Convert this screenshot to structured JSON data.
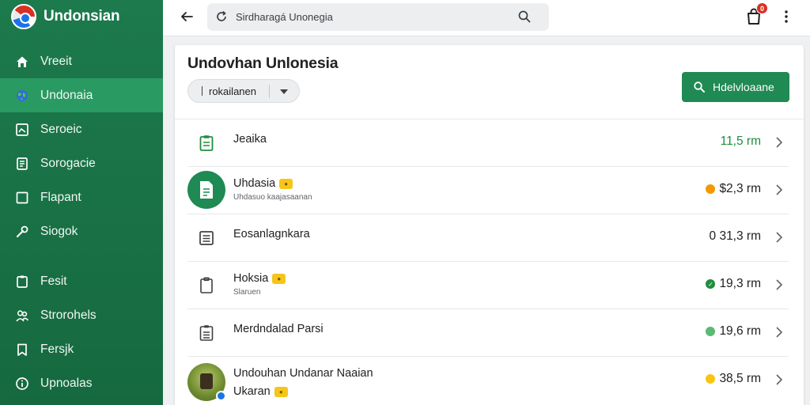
{
  "app": {
    "name": "Undonsian"
  },
  "sidebar": {
    "items": [
      {
        "label": "Vreeit",
        "icon": "home-icon"
      },
      {
        "label": "Undonaia",
        "icon": "globe-icon"
      },
      {
        "label": "Seroeic",
        "icon": "image-icon"
      },
      {
        "label": "Sorogacie",
        "icon": "document-icon"
      },
      {
        "label": "Flapant",
        "icon": "square-icon"
      },
      {
        "label": "Siogok",
        "icon": "wrench-icon"
      },
      {
        "label": "Fesit",
        "icon": "clipboard-icon"
      },
      {
        "label": "Strorohels",
        "icon": "people-icon"
      },
      {
        "label": "Fersjk",
        "icon": "bookmark-icon"
      },
      {
        "label": "Upnoalas",
        "icon": "info-icon"
      }
    ]
  },
  "topbar": {
    "search_text": "Sirdharagá Unonegia",
    "notification_count": "0"
  },
  "main": {
    "title": "Undovhan Unlonesia",
    "filter_label": "rokailanen",
    "primary_button_label": "Hdelvloaane",
    "rows": [
      {
        "title": "Jeaika",
        "subtitle": "",
        "amount": "11,5 rm",
        "status": "none",
        "amount_style": "green"
      },
      {
        "title": "Uhdasia",
        "subtitle": "Uhdasuo kaajasaanan",
        "amount": "$2,3 rm",
        "status": "orange"
      },
      {
        "title": "Eosanlagnkara",
        "subtitle": "",
        "amount": "0 31,3 rm",
        "status": "none"
      },
      {
        "title": "Hoksia",
        "subtitle": "Slaruen",
        "amount": "19,3 rm",
        "status": "green-icon"
      },
      {
        "title": "Merdndalad Parsi",
        "subtitle": "",
        "amount": "19,6 rm",
        "status": "lightgreen"
      },
      {
        "title": "Undouhan Undanar Naaian",
        "subtitle": "Ukaran",
        "amount": "38,5 rm",
        "status": "yellow"
      }
    ]
  },
  "colors": {
    "sidebar_bg": "#1c7a4c",
    "sidebar_active": "#2a9a63",
    "primary": "#1f8a53",
    "badge": "#d93025"
  }
}
